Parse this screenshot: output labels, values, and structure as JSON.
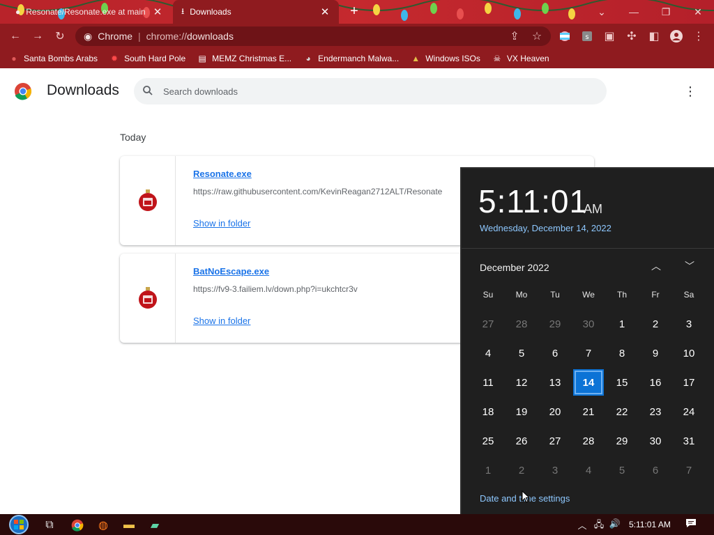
{
  "window": {
    "tabs": [
      {
        "title": "Resonate/Resonate.exe at main",
        "icon": "github-icon",
        "close": "✕"
      },
      {
        "title": "Downloads",
        "icon": "download-icon",
        "close": "✕"
      }
    ],
    "new_tab": "+",
    "controls": {
      "tab_search": "⌄",
      "minimize": "—",
      "restore": "❐",
      "close": "✕"
    }
  },
  "toolbar": {
    "omnibox_site": "Chrome",
    "omnibox_separator": "|",
    "omnibox_scheme": "chrome://",
    "omnibox_path": "downloads"
  },
  "bookmarks": [
    {
      "label": "Santa Bombs Arabs",
      "icon": "blood-drop-icon"
    },
    {
      "label": "South Hard Pole",
      "icon": "virus-icon"
    },
    {
      "label": "MEMZ Christmas E...",
      "icon": "page-icon"
    },
    {
      "label": "Endermanch Malwa...",
      "icon": "raccoon-icon"
    },
    {
      "label": "Windows ISOs",
      "icon": "tree-icon"
    },
    {
      "label": "VX Heaven",
      "icon": "skull-icon"
    }
  ],
  "page": {
    "title": "Downloads",
    "search_placeholder": "Search downloads",
    "section": "Today",
    "downloads": [
      {
        "name": "Resonate.exe",
        "url": "https://raw.githubusercontent.com/KevinReagan2712ALT/Resonate",
        "action": "Show in folder"
      },
      {
        "name": "BatNoEscape.exe",
        "url": "https://fv9-3.failiem.lv/down.php?i=ukchtcr3v",
        "action": "Show in folder"
      }
    ]
  },
  "clock": {
    "time": "5:11:01",
    "ampm": "AM",
    "long_date": "Wednesday, December 14, 2022",
    "month_label": "December 2022",
    "weekdays": [
      "Su",
      "Mo",
      "Tu",
      "We",
      "Th",
      "Fr",
      "Sa"
    ],
    "weeks": [
      [
        "27",
        "28",
        "29",
        "30",
        "1",
        "2",
        "3"
      ],
      [
        "4",
        "5",
        "6",
        "7",
        "8",
        "9",
        "10"
      ],
      [
        "11",
        "12",
        "13",
        "14",
        "15",
        "16",
        "17"
      ],
      [
        "18",
        "19",
        "20",
        "21",
        "22",
        "23",
        "24"
      ],
      [
        "25",
        "26",
        "27",
        "28",
        "29",
        "30",
        "31"
      ],
      [
        "1",
        "2",
        "3",
        "4",
        "5",
        "6",
        "7"
      ]
    ],
    "today": "14",
    "settings_link": "Date and time settings"
  },
  "taskbar": {
    "time": "5:11:01 AM"
  },
  "colors": {
    "titlebar": "#c5292e",
    "toolbar": "#8f1b1f",
    "link": "#1a73e8",
    "flyout_bg": "#1f1f1f",
    "flyout_accent": "#0c73d6"
  }
}
